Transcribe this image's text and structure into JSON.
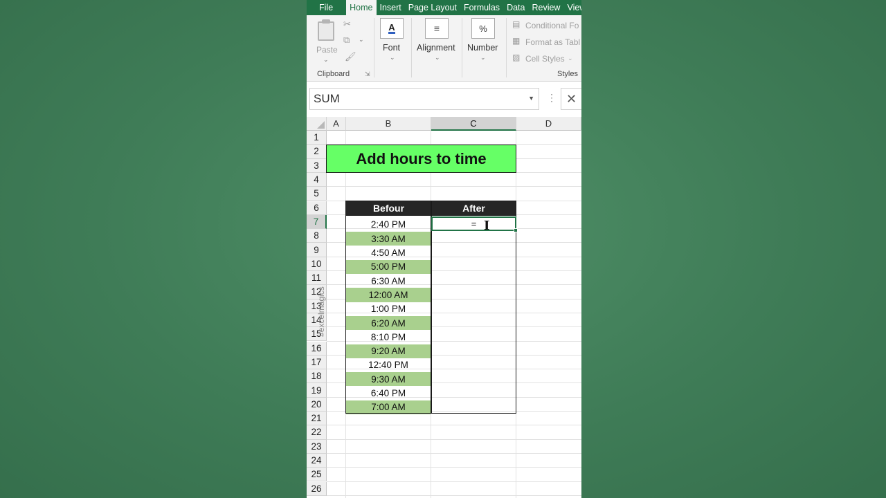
{
  "tabs": [
    {
      "label": "File"
    },
    {
      "label": "Home",
      "active": true
    },
    {
      "label": "Insert"
    },
    {
      "label": "Page Layout"
    },
    {
      "label": "Formulas"
    },
    {
      "label": "Data"
    },
    {
      "label": "Review"
    },
    {
      "label": "View"
    }
  ],
  "ribbon": {
    "clipboard": {
      "paste_label": "Paste",
      "group_label": "Clipboard"
    },
    "font": {
      "label": "Font"
    },
    "alignment": {
      "label": "Alignment"
    },
    "number": {
      "label": "Number"
    },
    "styles": {
      "conditional": "Conditional Fo",
      "format_table": "Format as Tabl",
      "cell_styles": "Cell Styles",
      "group_label": "Styles"
    }
  },
  "formula_bar": {
    "name_box": "SUM",
    "cancel": "✕"
  },
  "columns": [
    "A",
    "B",
    "C",
    "D"
  ],
  "rows": [
    "1",
    "2",
    "3",
    "4",
    "5",
    "6",
    "7",
    "8",
    "9",
    "10",
    "11",
    "12",
    "13",
    "14",
    "15",
    "16",
    "17",
    "18",
    "19",
    "20",
    "21",
    "22",
    "23",
    "24",
    "25",
    "26"
  ],
  "sheet": {
    "title": "Add hours to time",
    "header_before": "Befour",
    "header_after": "After",
    "times": [
      "2:40 PM",
      "3:30 AM",
      "4:50 AM",
      "5:00 PM",
      "6:30 AM",
      "12:00 AM",
      "1:00 PM",
      "6:20 AM",
      "8:10 PM",
      "9:20 AM",
      "12:40 PM",
      "9:30 AM",
      "6:40 PM",
      "7:00 AM"
    ],
    "active_cell_value": "=",
    "watermark": "#excelmagics"
  },
  "colors": {
    "excel_green": "#217346",
    "title_fill": "#66ff66",
    "band_fill": "#a9d08e"
  }
}
